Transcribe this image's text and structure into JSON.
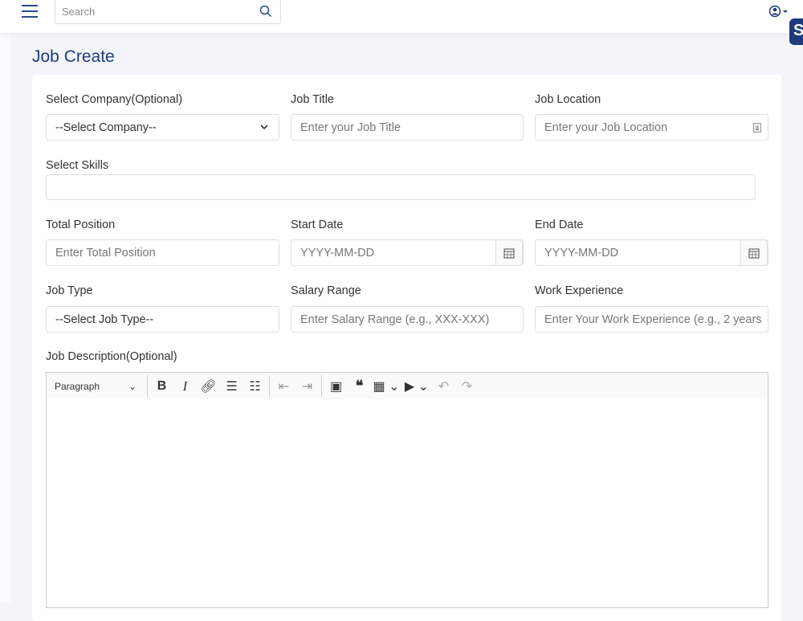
{
  "header": {
    "search_placeholder": "Search",
    "badge": "S"
  },
  "page": {
    "title": "Job Create"
  },
  "form": {
    "company": {
      "label": "Select Company(Optional)",
      "value": "--Select Company--"
    },
    "job_title": {
      "label": "Job Title",
      "placeholder": "Enter your Job Title"
    },
    "job_location": {
      "label": "Job Location",
      "placeholder": "Enter your Job Location"
    },
    "skills": {
      "label": "Select Skills"
    },
    "total_position": {
      "label": "Total Position",
      "placeholder": "Enter Total Position"
    },
    "start_date": {
      "label": "Start Date",
      "placeholder": "YYYY-MM-DD"
    },
    "end_date": {
      "label": "End Date",
      "placeholder": "YYYY-MM-DD"
    },
    "job_type": {
      "label": "Job Type",
      "value": "--Select Job Type--"
    },
    "salary": {
      "label": "Salary Range",
      "placeholder": "Enter Salary Range (e.g., XXX-XXX)"
    },
    "experience": {
      "label": "Work Experience",
      "placeholder": "Enter Your Work Experience (e.g., 2 years"
    },
    "description": {
      "label": "Job Description(Optional)",
      "format": "Paragraph"
    }
  }
}
